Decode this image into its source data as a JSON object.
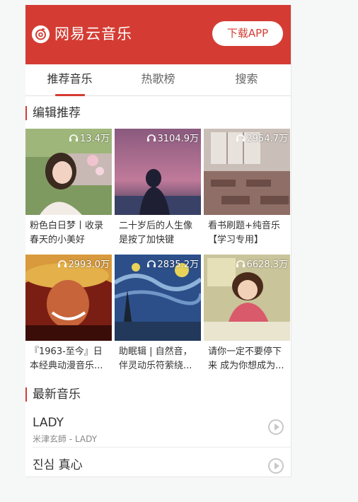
{
  "brand": {
    "name": "网易云音乐",
    "accent": "#d43c33"
  },
  "header": {
    "download_label": "下载APP"
  },
  "tabs": [
    {
      "label": "推荐音乐",
      "active": true
    },
    {
      "label": "热歌榜",
      "active": false
    },
    {
      "label": "搜索",
      "active": false
    }
  ],
  "recommend": {
    "title": "编辑推荐",
    "playlists": [
      {
        "count": "13.4万",
        "title": "粉色白日梦丨收录春天的小美好"
      },
      {
        "count": "3104.9万",
        "title": "二十岁后的人生像是按了加快键"
      },
      {
        "count": "2954.7万",
        "title": "看书刷题+纯音乐【学习专用】"
      },
      {
        "count": "2993.0万",
        "title": "『1963-至今』日本经典动漫音乐..."
      },
      {
        "count": "2835.2万",
        "title": "助眠辑 | 自然音，伴灵动乐符萦绕..."
      },
      {
        "count": "6628.3万",
        "title": "请你一定不要停下来 成为你想成为..."
      }
    ]
  },
  "newsongs": {
    "title": "最新音乐",
    "songs": [
      {
        "name": "LADY",
        "artist": "米津玄師 - LADY"
      },
      {
        "name": "진심 真心",
        "artist": ""
      }
    ]
  }
}
